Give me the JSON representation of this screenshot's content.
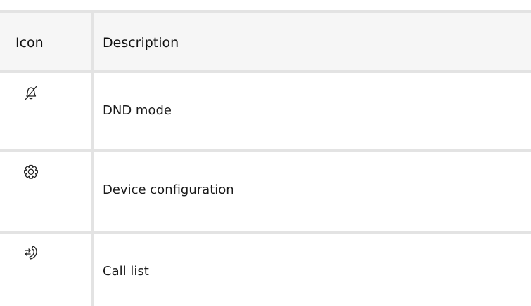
{
  "table": {
    "headers": {
      "icon": "Icon",
      "description": "Description"
    },
    "rows": [
      {
        "icon": "bell-off-icon",
        "description": "DND mode"
      },
      {
        "icon": "gear-icon",
        "description": "Device configuration"
      },
      {
        "icon": "call-list-icon",
        "description": "Call list"
      }
    ]
  },
  "colors": {
    "grid_line": "#e3e3e3",
    "header_background": "#f6f6f6",
    "text": "#1a1a1a"
  }
}
